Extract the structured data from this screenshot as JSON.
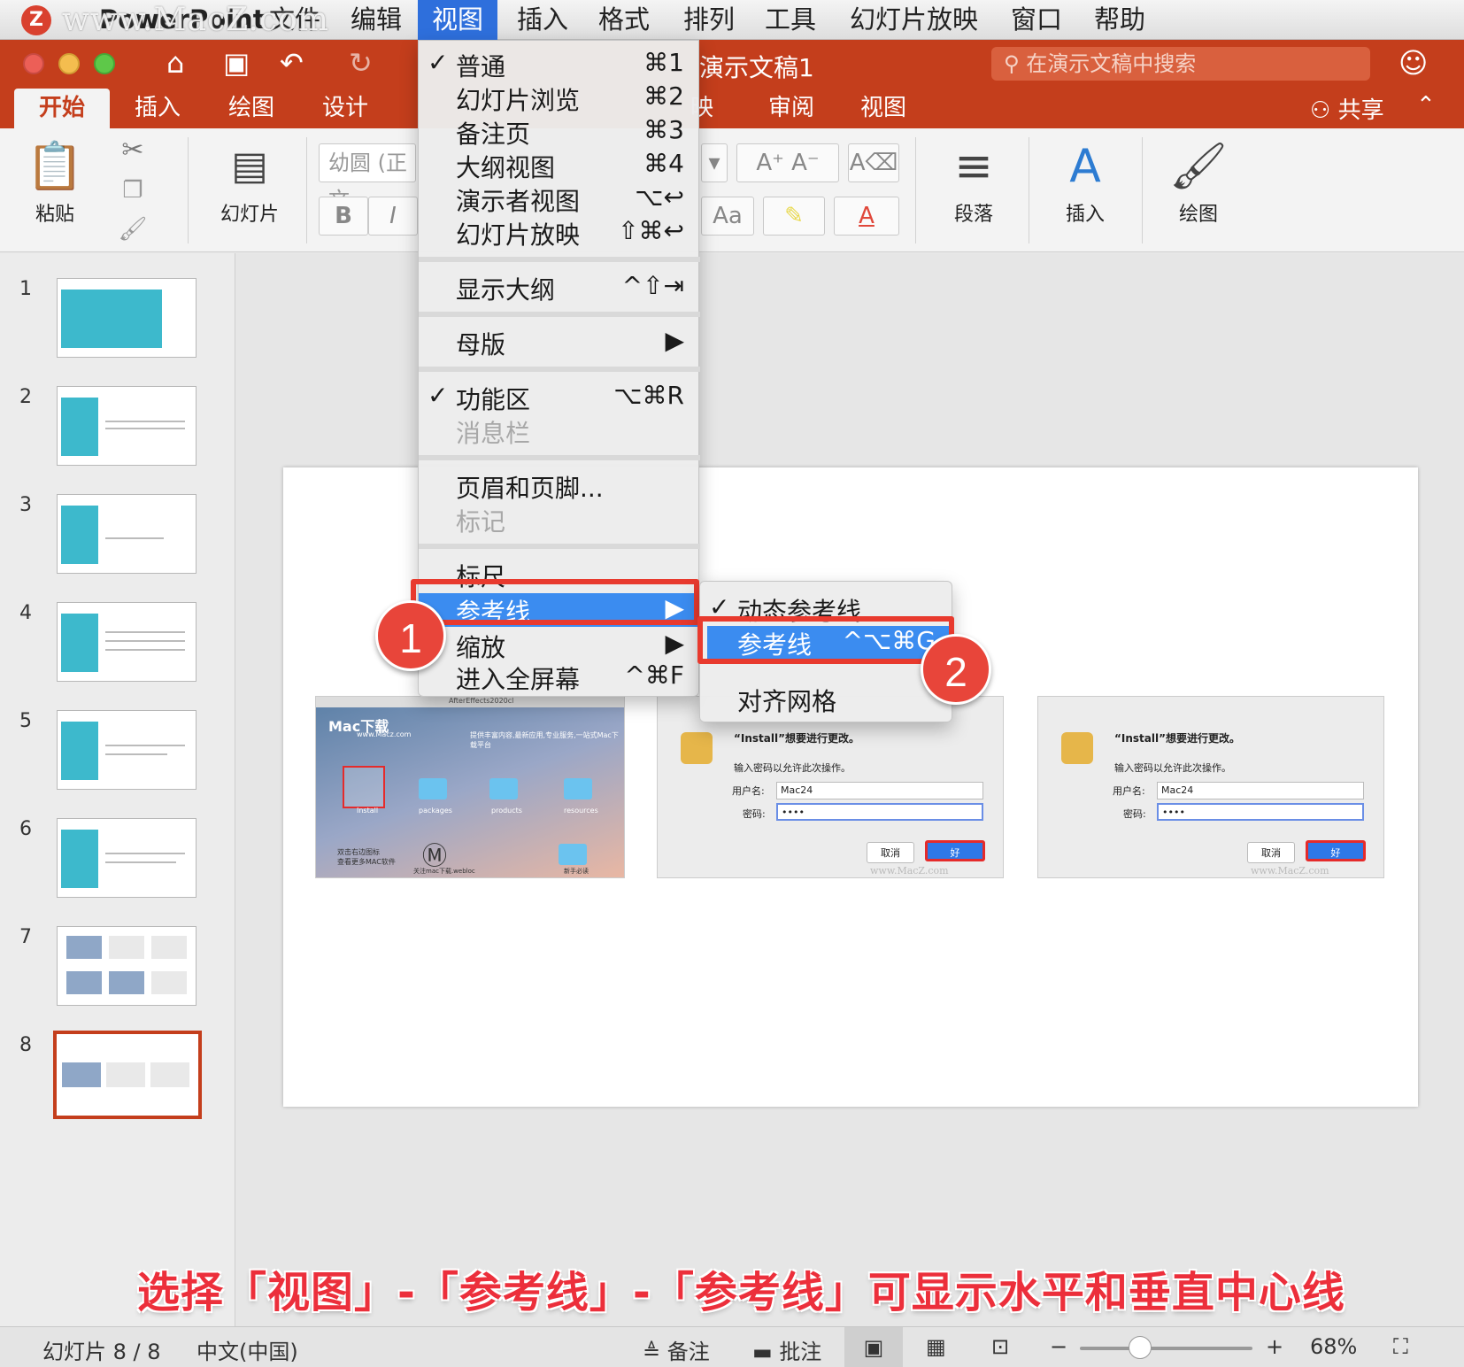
{
  "menubar": {
    "app_logo": "Z",
    "watermark": "www.MacZ.com",
    "items": [
      "PowerPoint",
      "文件",
      "编辑",
      "视图",
      "插入",
      "格式",
      "排列",
      "工具",
      "幻灯片放映",
      "窗口",
      "帮助"
    ],
    "active_item": "视图"
  },
  "window": {
    "doc_title": "演示文稿1",
    "search_placeholder": "在演示文稿中搜索",
    "colors": {
      "accent": "#c43e1c",
      "highlight": "#3b8cf0",
      "annotation_red": "#e83a2e"
    }
  },
  "ribbon_tabs": {
    "items": [
      "开始",
      "插入",
      "绘图",
      "设计",
      "映",
      "审阅",
      "视图"
    ],
    "active": "开始",
    "share_label": "共享"
  },
  "ribbon": {
    "paste": "粘贴",
    "slides": "幻灯片",
    "font_name": "幼圆 (正文",
    "bold": "B",
    "italic": "I",
    "paragraph": "段落",
    "insert": "插入",
    "draw": "绘图"
  },
  "view_menu": {
    "items": [
      {
        "label": "普通",
        "shortcut": "⌘1",
        "checked": true
      },
      {
        "label": "幻灯片浏览",
        "shortcut": "⌘2"
      },
      {
        "label": "备注页",
        "shortcut": "⌘3"
      },
      {
        "label": "大纲视图",
        "shortcut": "⌘4"
      },
      {
        "label": "演示者视图",
        "shortcut": "⌥↩"
      },
      {
        "label": "幻灯片放映",
        "shortcut": "⇧⌘↩"
      },
      {
        "label": "显示大纲",
        "shortcut": "^⇧⇥"
      },
      {
        "label": "母版",
        "shortcut": "▶"
      },
      {
        "label": "功能区",
        "shortcut": "⌥⌘R",
        "checked": true
      },
      {
        "label": "消息栏",
        "disabled": true
      },
      {
        "label": "页眉和页脚..."
      },
      {
        "label": "标记",
        "disabled": true
      },
      {
        "label": "标尺"
      },
      {
        "label": "参考线",
        "shortcut": "▶",
        "highlighted": true
      },
      {
        "label": "缩放",
        "shortcut": "▶"
      },
      {
        "label": "进入全屏幕",
        "shortcut": "^⌘F"
      }
    ],
    "check_mark": "✓"
  },
  "guides_submenu": {
    "items": [
      {
        "label": "动态参考线",
        "checked": true
      },
      {
        "label": "参考线",
        "shortcut": "^⌥⌘G",
        "highlighted": true
      },
      {
        "label": "对齐网格"
      }
    ]
  },
  "badges": [
    "1",
    "2"
  ],
  "thumbnails": {
    "numbers": [
      "1",
      "2",
      "3",
      "4",
      "5",
      "6",
      "7",
      "8"
    ],
    "selected": "8"
  },
  "slide_content": {
    "shot1": {
      "brand": "Mac下载",
      "brand_url": "www.Macz.com",
      "window_title": "AfterEffects2020cl",
      "tagline": "提供丰富内容,最新应用,专业服务,一站式Mac下载平台",
      "folders": [
        "Install",
        "packages",
        "products",
        "resources"
      ],
      "bottom_left": "双击右边图标\n查看更多MAC软件",
      "bottom_mid": "关注mac下载.webloc",
      "bottom_right": "新手必读"
    },
    "dialog": {
      "title": "“Install”想要进行更改。",
      "subtitle": "输入密码以允许此次操作。",
      "username_label": "用户名:",
      "username_value": "Mac24",
      "password_label": "密码:",
      "password_value": "••••",
      "cancel": "取消",
      "ok": "好",
      "watermark": "www.MacZ.com"
    }
  },
  "caption": "选择「视图」-「参考线」-「参考线」可显示水平和垂直中心线",
  "status_bar": {
    "slide_info": "幻灯片 8 / 8",
    "language": "中文(中国)",
    "notes": "备注",
    "comments": "批注",
    "zoom": "68%",
    "zoom_fraction": 0.35
  }
}
